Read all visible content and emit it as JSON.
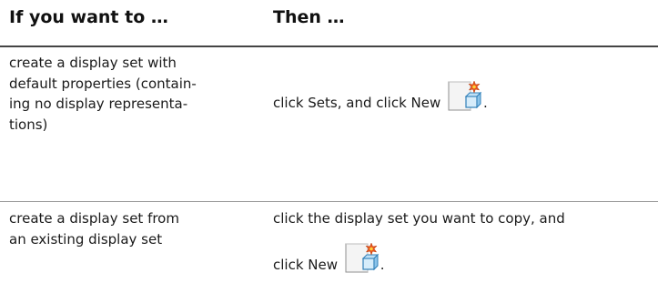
{
  "table": {
    "headers": {
      "left": "If you want to …",
      "right": "Then …"
    },
    "rows": [
      {
        "left_lines": [
          "create a display set with",
          "default properties (contain-",
          "ing no display representa-",
          "tions)"
        ],
        "right_lines": [
          "click Sets, and click New"
        ],
        "right_suffix": ".",
        "icon": "new-display-set-icon"
      },
      {
        "left_lines": [
          "create a display set from",
          "an existing display set"
        ],
        "right_lines": [
          "click the display set you want to copy, and",
          "click New"
        ],
        "right_suffix": ".",
        "icon": "new-display-set-icon"
      }
    ]
  },
  "colors": {
    "text": "#1a1a1a",
    "rule": "#444444",
    "icon_star": "#e8541c",
    "icon_blue": "#4aa0d8"
  }
}
